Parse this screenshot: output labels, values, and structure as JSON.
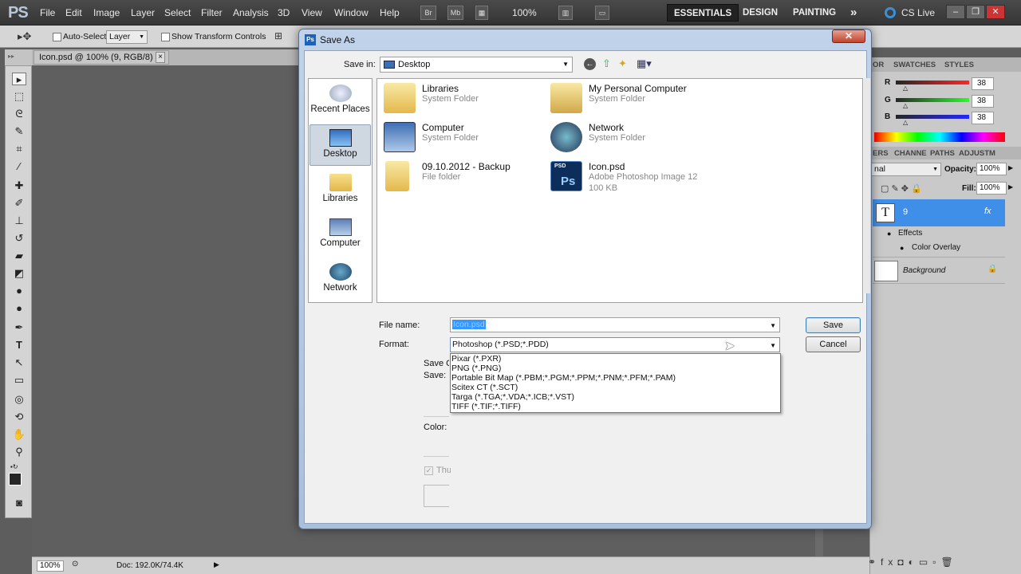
{
  "app": {
    "logo": "PS",
    "menus": [
      "File",
      "Edit",
      "Image",
      "Layer",
      "Select",
      "Filter",
      "Analysis",
      "3D",
      "View",
      "Window",
      "Help"
    ],
    "zoom": "100%",
    "workspaces": [
      "ESSENTIALS",
      "DESIGN",
      "PAINTING"
    ],
    "overflow": "»",
    "cs_live": "CS Live"
  },
  "options": {
    "auto_select_label": "Auto-Select:",
    "auto_select_value": "Layer",
    "show_transform_label": "Show Transform Controls"
  },
  "document": {
    "tab_label": "Icon.psd @ 100% (9, RGB/8) *",
    "tab_close": "×"
  },
  "status": {
    "zoom": "100%",
    "doc_info": "Doc: 192.0K/74.4K"
  },
  "panels": {
    "color_tabs": [
      "OR",
      "SWATCHES",
      "STYLES"
    ],
    "r_label": "R",
    "g_label": "G",
    "b_label": "B",
    "r_value": "38",
    "g_value": "38",
    "b_value": "38",
    "layer_tabs": [
      "ERS",
      "CHANNE",
      "PATHS",
      "ADJUSTM"
    ],
    "blend_mode": "nal",
    "opacity_label": "Opacity:",
    "opacity_value": "100%",
    "fill_label": "Fill:",
    "fill_value": "100%",
    "layers": {
      "text_layer_name": "9",
      "text_layer_fx": "fx",
      "effects_label": "Effects",
      "color_overlay_label": "Color Overlay",
      "background_label": "Background"
    }
  },
  "dialog": {
    "title": "Save As",
    "title_icon": "Ps",
    "close": "✕",
    "save_in_label": "Save in:",
    "save_in_value": "Desktop",
    "places": [
      "Recent Places",
      "Desktop",
      "Libraries",
      "Computer",
      "Network"
    ],
    "items": [
      {
        "name": "Libraries",
        "sub": "System Folder"
      },
      {
        "name": "My Personal Computer",
        "sub": "System Folder"
      },
      {
        "name": "Computer",
        "sub": "System Folder"
      },
      {
        "name": "Network",
        "sub": "System Folder"
      },
      {
        "name": "09.10.2012 - Backup",
        "sub": "File folder"
      },
      {
        "name": "Icon.psd",
        "sub": "Adobe Photoshop Image 12",
        "sub2": "100 KB"
      }
    ],
    "psd_badge": "PSD",
    "ps_badge": "Ps",
    "file_name_label": "File name:",
    "file_name_value": "Icon.psd",
    "format_label": "Format:",
    "format_value": "Photoshop (*.PSD;*.PDD)",
    "format_options": [
      "Pixar (*.PXR)",
      "PNG (*.PNG)",
      "Portable Bit Map (*.PBM;*.PGM;*.PPM;*.PNM;*.PFM;*.PAM)",
      "Scitex CT (*.SCT)",
      "Targa (*.TGA;*.VDA;*.ICB;*.VST)",
      "TIFF (*.TIF;*.TIFF)"
    ],
    "save_button": "Save",
    "cancel_button": "Cancel",
    "save_options_clipped": "Save O",
    "save_clipped": "Save:",
    "color_label": "Color:",
    "thumbnail_clipped": "Thu"
  }
}
